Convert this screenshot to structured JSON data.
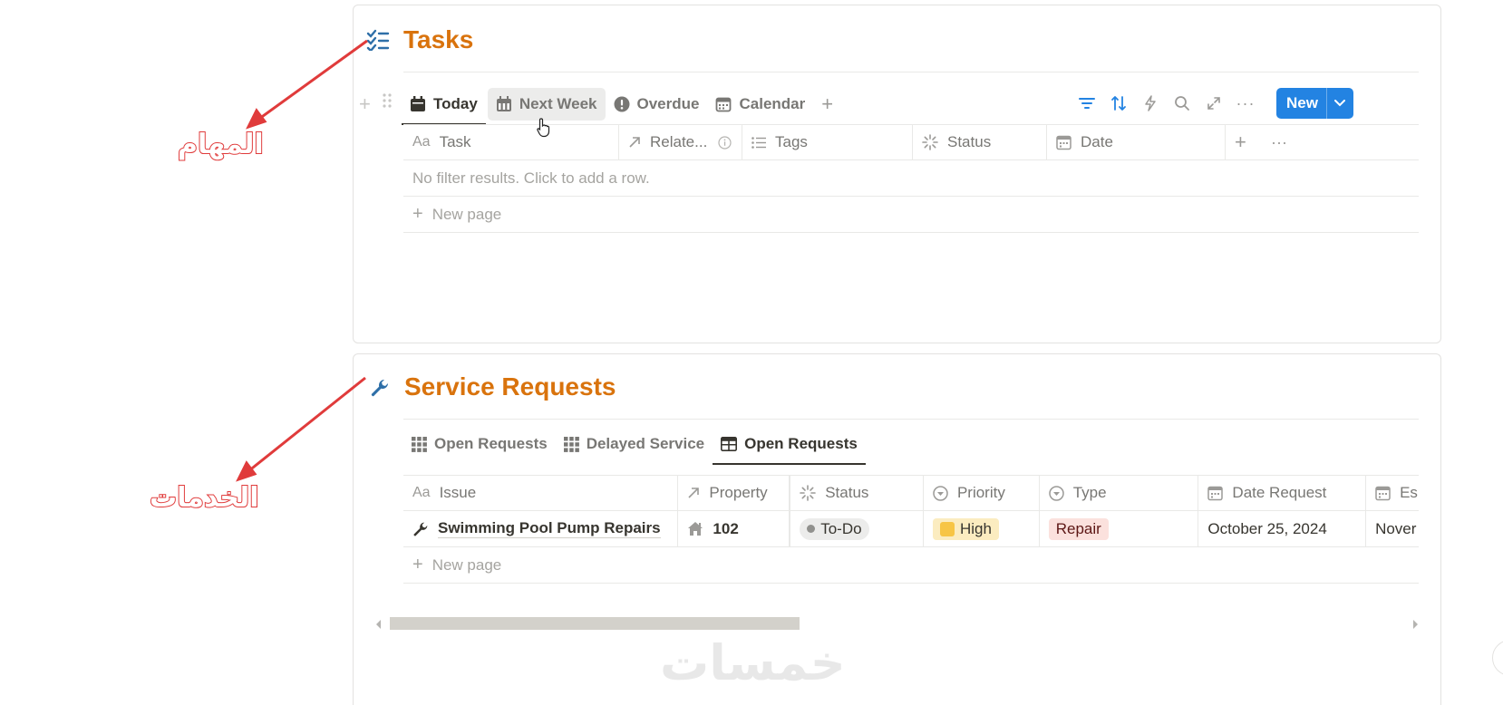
{
  "tasks": {
    "title": "Tasks",
    "tabs": [
      {
        "label": "Today",
        "icon": "calendar-day-icon",
        "active": true
      },
      {
        "label": "Next Week",
        "icon": "calendar-week-icon"
      },
      {
        "label": "Overdue",
        "icon": "alert-circle-icon"
      },
      {
        "label": "Calendar",
        "icon": "calendar-icon"
      }
    ],
    "new_button": "New",
    "columns": [
      {
        "label": "Task",
        "icon": "text-Aa-icon"
      },
      {
        "label": "Relate...",
        "icon": "relation-arrow-icon"
      },
      {
        "label": "Tags",
        "icon": "list-icon"
      },
      {
        "label": "Status",
        "icon": "status-spinner-icon"
      },
      {
        "label": "Date",
        "icon": "calendar-icon"
      }
    ],
    "empty_text": "No filter results. Click to add a row.",
    "new_page": "New page"
  },
  "services": {
    "title": "Service Requests",
    "tabs": [
      {
        "label": "Open Requests",
        "icon": "grid-icon"
      },
      {
        "label": "Delayed Service",
        "icon": "grid-icon"
      },
      {
        "label": "Open Requests",
        "icon": "table-icon",
        "active": true
      }
    ],
    "columns": [
      {
        "label": "Issue",
        "icon": "text-Aa-icon"
      },
      {
        "label": "Property",
        "icon": "relation-arrow-icon"
      },
      {
        "label": "Status",
        "icon": "status-spinner-icon"
      },
      {
        "label": "Priority",
        "icon": "select-icon"
      },
      {
        "label": "Type",
        "icon": "select-icon"
      },
      {
        "label": "Date Request",
        "icon": "calendar-icon"
      },
      {
        "label": "Es",
        "icon": "calendar-icon"
      }
    ],
    "rows": [
      {
        "issue": "Swimming Pool Pump Repairs",
        "property": "102",
        "status": "To-Do",
        "priority": "High",
        "type": "Repair",
        "date_request": "October 25, 2024",
        "estimate": "Nover"
      }
    ],
    "new_page": "New page"
  },
  "annotations": {
    "tasks_label": "المهام",
    "services_label": "الخدمات"
  },
  "watermark": "خمسات",
  "colors": {
    "title": "#d9730d",
    "accent": "#2383e2",
    "arrow": "#e03b3b"
  }
}
